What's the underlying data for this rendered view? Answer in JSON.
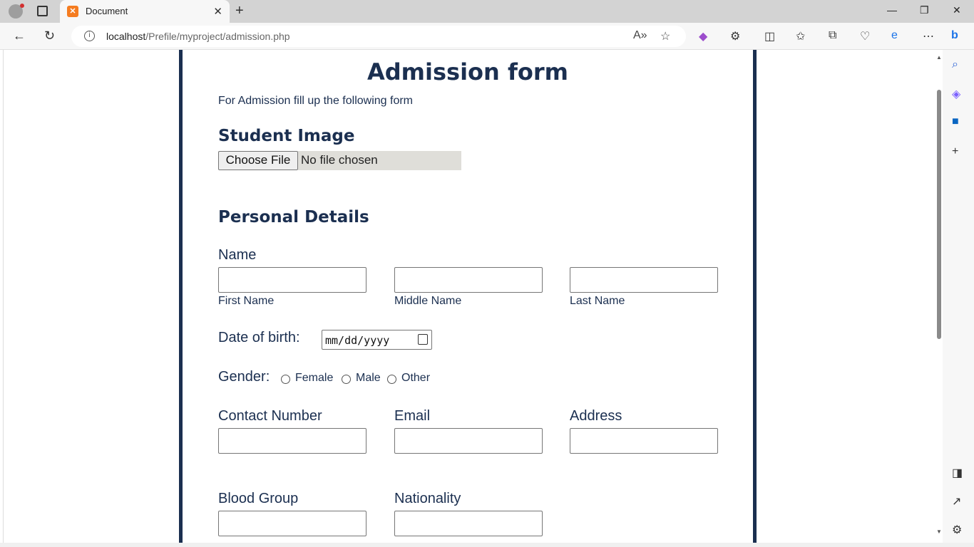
{
  "browser": {
    "tab_title": "Document",
    "tab_favicon": "xampp-icon",
    "url_host": "localhost",
    "url_path": "/Prefile/myproject/admission.php"
  },
  "form": {
    "title": "Admission form",
    "intro": "For Admission fill up the following form",
    "student_image_heading": "Student Image",
    "file_button": "Choose File",
    "file_status": "No file chosen",
    "personal_heading": "Personal Details",
    "name_label": "Name",
    "first_name": "First Name",
    "middle_name": "Middle Name",
    "last_name": "Last Name",
    "dob_label": "Date of birth:",
    "dob_placeholder": "mm/dd/yyyy",
    "gender_label": "Gender:",
    "gender_options": [
      "Female",
      "Male",
      "Other"
    ],
    "contact_label": "Contact Number",
    "email_label": "Email",
    "address_label": "Address",
    "blood_label": "Blood Group",
    "nationality_label": "Nationality"
  },
  "colors": {
    "accent": "#1b2f50"
  }
}
